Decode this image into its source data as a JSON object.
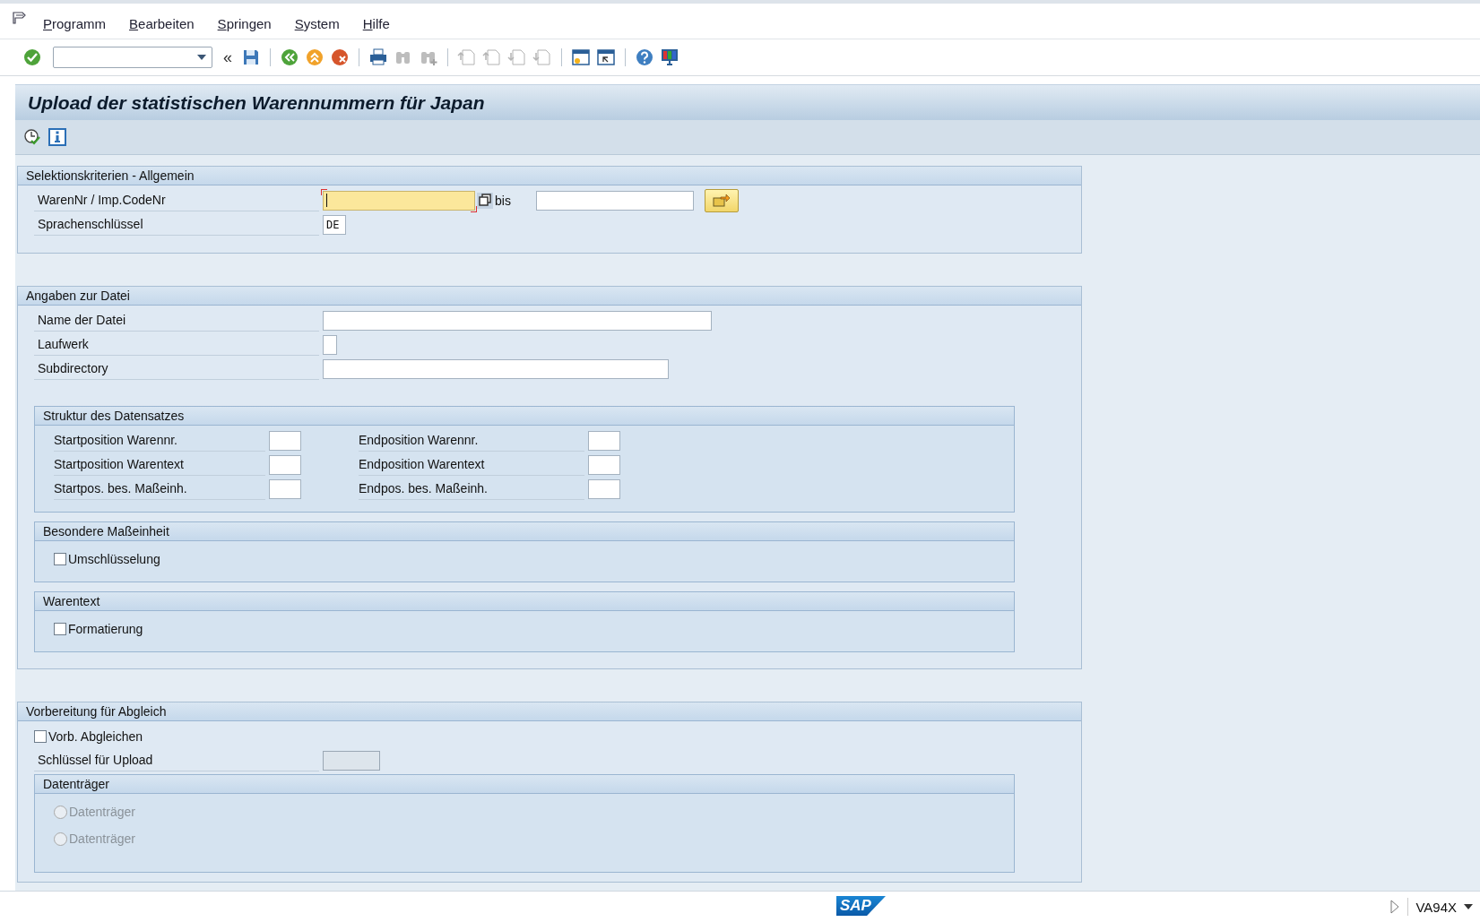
{
  "menu": [
    {
      "label": "Programm"
    },
    {
      "label": "Bearbeiten"
    },
    {
      "label": "Springen"
    },
    {
      "label": "System"
    },
    {
      "label": "Hilfe"
    }
  ],
  "toolbar": [
    {
      "kind": "enter",
      "disabled": false
    },
    {
      "kind": "command_field"
    },
    {
      "kind": "collapse",
      "label": "«"
    },
    {
      "kind": "save",
      "disabled": false
    },
    {
      "kind": "separator"
    },
    {
      "kind": "back",
      "disabled": false
    },
    {
      "kind": "exit",
      "disabled": false
    },
    {
      "kind": "cancel",
      "disabled": false
    },
    {
      "kind": "separator"
    },
    {
      "kind": "print",
      "disabled": false
    },
    {
      "kind": "find",
      "disabled": true
    },
    {
      "kind": "find_next",
      "disabled": true
    },
    {
      "kind": "separator"
    },
    {
      "kind": "first_page",
      "disabled": true
    },
    {
      "kind": "previous_page",
      "disabled": true
    },
    {
      "kind": "next_page",
      "disabled": true
    },
    {
      "kind": "last_page",
      "disabled": true
    },
    {
      "kind": "separator"
    },
    {
      "kind": "new_session",
      "disabled": false
    },
    {
      "kind": "shortcut",
      "disabled": false
    },
    {
      "kind": "separator"
    },
    {
      "kind": "help",
      "disabled": false
    },
    {
      "kind": "layout",
      "disabled": false
    }
  ],
  "title": "Upload der statistischen Warennummern für Japan",
  "app_toolbar": [
    {
      "kind": "execute"
    },
    {
      "kind": "info"
    }
  ],
  "selection": {
    "title": "Selektionskriterien - Allgemein",
    "range": {
      "label": "WarenNr / Imp.CodeNr",
      "focused": true,
      "to_label": "bis"
    },
    "language": {
      "label": "Sprachenschlüssel",
      "value": "DE"
    }
  },
  "file": {
    "title": "Angaben zur Datei",
    "fields": [
      {
        "label": "Name der Datei"
      },
      {
        "label": "Laufwerk"
      },
      {
        "label": "Subdirectory"
      }
    ],
    "structure": {
      "title": "Struktur des Datensatzes",
      "rows": [
        {
          "start": "Startposition Warennr.",
          "end": "Endposition Warennr."
        },
        {
          "start": "Startposition Warentext",
          "end": "Endposition Warentext"
        },
        {
          "start": "Startpos. bes. Maßeinh.",
          "end": "Endpos. bes. Maßeinh."
        }
      ]
    },
    "groups": [
      {
        "title": "Besondere Maßeinheit",
        "checkbox": {
          "label": "Umschlüsselung",
          "checked": false
        }
      },
      {
        "title": "Warentext",
        "checkbox": {
          "label": "Formatierung",
          "checked": false
        }
      }
    ]
  },
  "reconcile": {
    "title": "Vorbereitung für Abgleich",
    "checkbox": {
      "label": "Vorb. Abgleichen",
      "checked": false
    },
    "key_field": {
      "label": "Schlüssel für Upload",
      "disabled": true
    },
    "media": {
      "title": "Datenträger",
      "options": [
        {
          "label": "Datenträger",
          "selected": false,
          "disabled": true
        },
        {
          "label": "Datenträger",
          "selected": false,
          "disabled": true
        }
      ]
    }
  },
  "status_bar": {
    "logo": "SAP",
    "transaction": "VA94X"
  }
}
